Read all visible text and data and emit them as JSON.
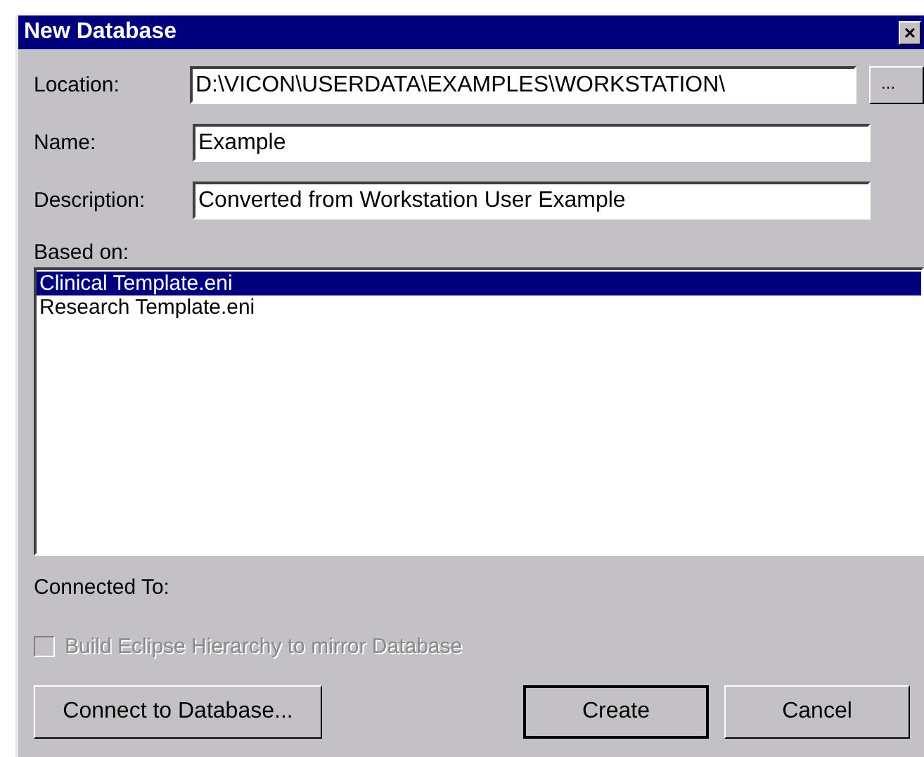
{
  "window": {
    "title": "New Database",
    "close": "×"
  },
  "fields": [
    {
      "label": "Location:",
      "value": "D:\\VICON\\USERDATA\\EXAMPLES\\WORKSTATION\\",
      "browse": "..."
    },
    {
      "label": "Name:",
      "value": "Example"
    },
    {
      "label": "Description:",
      "value": "Converted from Workstation User Example"
    }
  ],
  "based_on": {
    "label": "Based on:",
    "items": [
      {
        "label": "Clinical Template.eni",
        "selected": true
      },
      {
        "label": "Research Template.eni",
        "selected": false
      }
    ]
  },
  "connected_to": {
    "label": "Connected To:"
  },
  "hierarchy_checkbox": {
    "label": "Build Eclipse Hierarchy to mirror Database",
    "checked": false,
    "disabled": true
  },
  "buttons": [
    {
      "label": "Connect to Database...",
      "kind": "left"
    },
    {
      "label": "Create",
      "kind": "default"
    },
    {
      "label": "Cancel",
      "kind": "normal"
    }
  ]
}
